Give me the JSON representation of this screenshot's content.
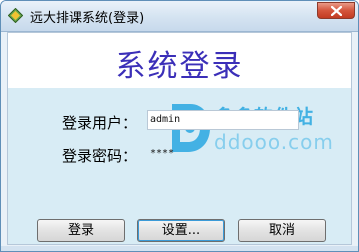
{
  "window": {
    "title": "远大排课系统(登录)"
  },
  "header": {
    "heading": "系统登录"
  },
  "form": {
    "username_label": "登录用户：",
    "username_value": "admin",
    "password_label": "登录密码：",
    "password_value": "****"
  },
  "buttons": {
    "login": "登录",
    "settings": "设置...",
    "cancel": "取消"
  },
  "watermark": {
    "cn_text": "多多软件站",
    "en_text": "ddooo.com"
  },
  "icons": {
    "app": "app-diamond-icon",
    "close": "close-icon",
    "watermark_logo": "ddooo-logo-icon"
  },
  "colors": {
    "heading": "#3b2fb8",
    "body_panel": "#d8ecf5",
    "close_button": "#d4553c"
  }
}
